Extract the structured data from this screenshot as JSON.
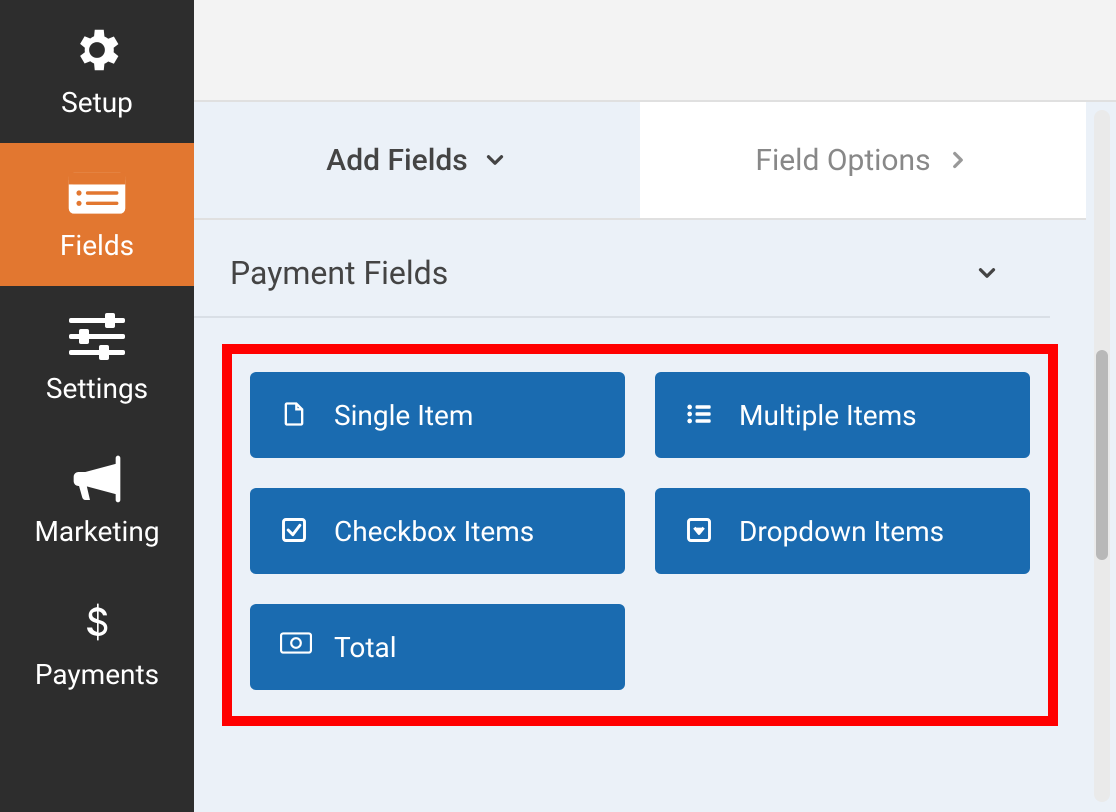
{
  "sidebar": {
    "items": [
      {
        "label": "Setup",
        "icon": "gear-icon"
      },
      {
        "label": "Fields",
        "icon": "fields-icon"
      },
      {
        "label": "Settings",
        "icon": "sliders-icon"
      },
      {
        "label": "Marketing",
        "icon": "bullhorn-icon"
      },
      {
        "label": "Payments",
        "icon": "dollar-icon"
      }
    ]
  },
  "tabs": {
    "add_fields": "Add Fields",
    "field_options": "Field Options"
  },
  "section": {
    "title": "Payment Fields"
  },
  "fields": {
    "single_item": "Single Item",
    "multiple_items": "Multiple Items",
    "checkbox_items": "Checkbox Items",
    "dropdown_items": "Dropdown Items",
    "total": "Total"
  },
  "colors": {
    "accent": "#e27730",
    "button": "#1a6bb0",
    "highlight": "#ff0000"
  }
}
